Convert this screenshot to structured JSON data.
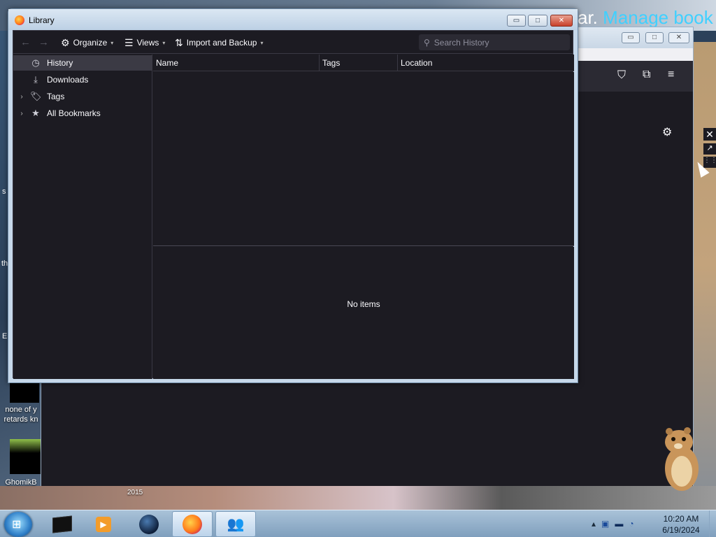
{
  "background": {
    "title_text": "ar.",
    "title_link": "Manage book",
    "tab_thumb_label": "2015"
  },
  "desktop_icons": [
    {
      "label": "none of y retards kn"
    },
    {
      "label": "GhomikB"
    }
  ],
  "edge_letters": [
    "s",
    "th",
    "E"
  ],
  "library": {
    "title": "Library",
    "toolbar": {
      "organize": "Organize",
      "views": "Views",
      "import_backup": "Import and Backup",
      "search_placeholder": "Search History"
    },
    "tree": [
      {
        "label": "History",
        "icon": "clock-icon",
        "selected": true,
        "expandable": false
      },
      {
        "label": "Downloads",
        "icon": "download-icon",
        "selected": false,
        "expandable": false
      },
      {
        "label": "Tags",
        "icon": "tag-icon",
        "selected": false,
        "expandable": true
      },
      {
        "label": "All Bookmarks",
        "icon": "star-icon",
        "selected": false,
        "expandable": true
      }
    ],
    "columns": [
      "Name",
      "Tags",
      "Location"
    ],
    "empty_message": "No items"
  },
  "taskbar": {
    "apps": [
      {
        "name": "app-dark-box"
      },
      {
        "name": "media-player"
      },
      {
        "name": "globe-app"
      },
      {
        "name": "firefox",
        "active": true
      },
      {
        "name": "network-users",
        "active": true
      }
    ],
    "clock_time": "10:20 AM",
    "clock_date": "6/19/2024"
  },
  "colors": {
    "panel_bg": "#1c1b22",
    "selected_row": "#3b3a44",
    "text": "#fbfbfe",
    "accent_link": "#3fd0ff"
  }
}
